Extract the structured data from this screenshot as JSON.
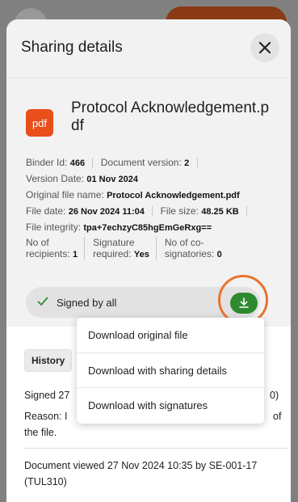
{
  "sheet": {
    "title": "Sharing details"
  },
  "document": {
    "type_badge": "pdf",
    "name": "Protocol Acknowledgement.pdf"
  },
  "meta": {
    "binder_id_label": "Binder Id:",
    "binder_id": "466",
    "doc_version_label": "Document version:",
    "doc_version": "2",
    "version_date_label": "Version Date:",
    "version_date": "01 Nov 2024",
    "original_name_label": "Original file name:",
    "original_name": "Protocol Acknowledgement.pdf",
    "file_date_label": "File date:",
    "file_date": "26 Nov 2024 11:04",
    "file_size_label": "File size:",
    "file_size": "48.25 KB",
    "integrity_label": "File integrity:",
    "integrity": "tpa+7echzyC85hgEmGeRxg=="
  },
  "stats": {
    "recipients_label_1": "No of",
    "recipients_label_2": "recipients:",
    "recipients": "1",
    "signature_label_1": "Signature",
    "signature_label_2": "required:",
    "signature": "Yes",
    "cosigners_label_1": "No of co-",
    "cosigners_label_2": "signatories:",
    "cosigners": "0"
  },
  "status": {
    "label": "Signed by all"
  },
  "history": {
    "tag": "History",
    "line1_start": "Signed 27",
    "line1_end": "0)",
    "line2_start": "Reason: I",
    "line2_end": "of",
    "line3": "the file.",
    "line4": "Document viewed 27 Nov 2024 10:35 by SE-001-17",
    "line5": "(TUL310)"
  },
  "menu": {
    "items": [
      {
        "label": "Download original file"
      },
      {
        "label": "Download with sharing details"
      },
      {
        "label": "Download with signatures"
      }
    ]
  },
  "colors": {
    "pdf_badge": "#ea4e1b",
    "download_button": "#2f8a2f",
    "highlight_ring": "#e8742c"
  }
}
